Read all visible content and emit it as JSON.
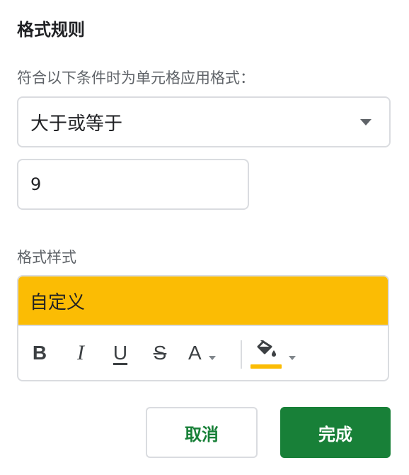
{
  "panel": {
    "title": "格式规则",
    "condition_label": "符合以下条件时为单元格应用格式："
  },
  "condition": {
    "selected": "大于或等于",
    "value": "9"
  },
  "style": {
    "label": "格式样式",
    "preview_text": "自定义",
    "preview_bg": "#fbbc04",
    "toolbar": {
      "bold": "B",
      "italic": "I",
      "underline": "U",
      "strikethrough": "S",
      "text_color": "A",
      "fill_color": "#fbbc04"
    }
  },
  "actions": {
    "cancel": "取消",
    "done": "完成"
  },
  "colors": {
    "accent_green": "#188038",
    "preview_yellow": "#fbbc04"
  }
}
